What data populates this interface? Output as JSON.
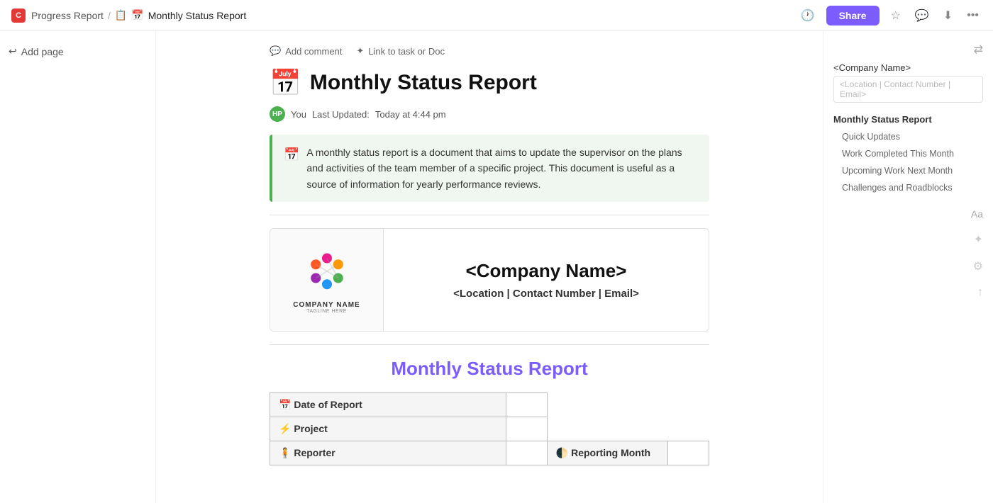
{
  "topbar": {
    "logo_label": "C",
    "breadcrumb_app": "Progress Report",
    "breadcrumb_sep": "/",
    "breadcrumb_doc_icon": "📋",
    "breadcrumb_doc_title": "Monthly Status Report",
    "share_label": "Share"
  },
  "sidebar": {
    "add_page_label": "Add page"
  },
  "toolbar": {
    "add_comment_label": "Add comment",
    "link_label": "Link to task or Doc"
  },
  "doc": {
    "icon": "📅",
    "title": "Monthly Status Report",
    "author": "You",
    "last_updated_label": "Last Updated:",
    "last_updated_value": "Today at 4:44 pm",
    "callout_text": "A monthly status report is a document that aims to update the supervisor on the plans and activities of the team member of a specific project. This document is useful as a source of information for yearly performance reviews."
  },
  "company_card": {
    "logo_name": "COMPANY NAME",
    "logo_tagline": "TAGLINE HERE",
    "name": "<Company Name>",
    "details": "<Location | Contact Number | Email>"
  },
  "section_title": "Monthly Status Report",
  "table": {
    "rows": [
      {
        "icon": "📅",
        "label": "Date of Report",
        "value": "",
        "second_icon": "",
        "second_label": "",
        "second_value": ""
      },
      {
        "icon": "⚡",
        "label": "Project",
        "value": "",
        "second_icon": "",
        "second_label": "",
        "second_value": ""
      },
      {
        "icon": "🧍",
        "label": "Reporter",
        "value": "",
        "second_icon": "🌓",
        "second_label": "Reporting Month",
        "second_value": ""
      }
    ]
  },
  "right_panel": {
    "company_name": "<Company Name>",
    "location_placeholder": "<Location | Contact Number | Email>",
    "nav_items": [
      {
        "label": "Monthly Status Report",
        "type": "bold"
      },
      {
        "label": "Quick Updates",
        "type": "sub"
      },
      {
        "label": "Work Completed This Month",
        "type": "sub"
      },
      {
        "label": "Upcoming Work Next Month",
        "type": "sub"
      },
      {
        "label": "Challenges and Roadblocks",
        "type": "sub"
      }
    ],
    "font_label": "Aa"
  }
}
